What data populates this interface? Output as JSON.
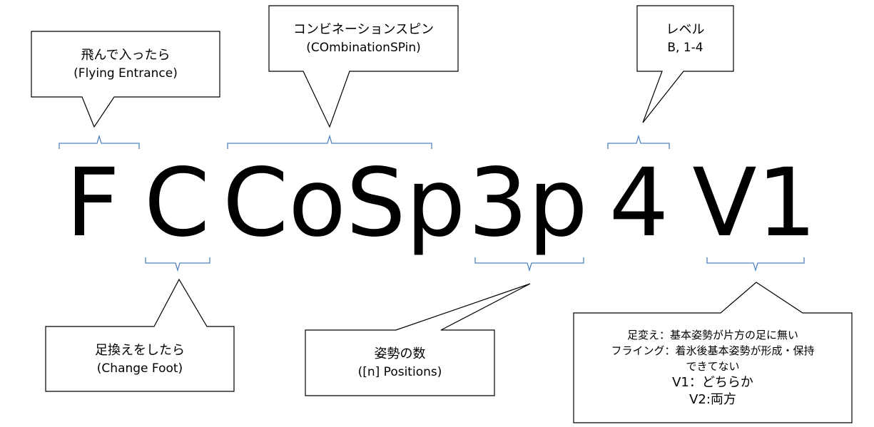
{
  "code": {
    "flying": "F",
    "change_foot": "C",
    "type": "CoSp",
    "positions": "3p",
    "level": "4",
    "variation": "V1"
  },
  "callouts": {
    "flying": {
      "line1": "飛んで入ったら",
      "line2": "(Flying Entrance)"
    },
    "combination": {
      "line1": "コンビネーションスピン",
      "line2": "(COmbinationSPin)"
    },
    "level": {
      "line1": "レベル",
      "line2": "B, 1-4"
    },
    "change_foot": {
      "line1": "足換えをしたら",
      "line2": "(Change Foot)"
    },
    "positions": {
      "line1": "姿勢の数",
      "line2": "([n] Positions)"
    },
    "variation": {
      "line1": "足変え：基本姿勢が片方の足に無い",
      "line2": "フライング：着氷後基本姿勢が形成・保持",
      "line3": "できてない",
      "line4": "V1：どちらか",
      "line5": "V2:両方"
    }
  },
  "colors": {
    "bracket": "#4F81BD",
    "box_border": "#000000",
    "text": "#000000"
  }
}
